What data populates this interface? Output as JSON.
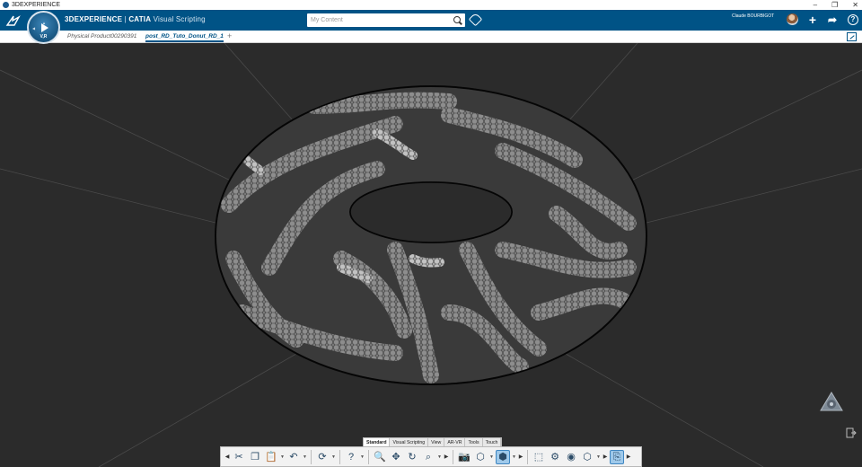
{
  "os_window": {
    "title": "3DEXPERIENCE",
    "controls": [
      "–",
      "❐",
      "✕"
    ]
  },
  "header": {
    "compass_label": "V,R",
    "brand_bold": "3DEXPERIENCE",
    "brand_sep": " | ",
    "brand_product": "CATIA",
    "app_name": " Visual Scripting",
    "search_placeholder": "My Content",
    "user_name": "Claude BOURBIGOT",
    "add_label": "+",
    "share_label": "➦",
    "help_label": "?"
  },
  "tabs": [
    {
      "label": "Physical Product00290391",
      "active": false
    },
    {
      "label": "post_RD_Tuto_Donut_RD_1",
      "active": true
    }
  ],
  "tab_add": "+",
  "action_bar": {
    "sections": [
      {
        "label": "Standard",
        "active": true
      },
      {
        "label": "Visual Scripting",
        "active": false
      },
      {
        "label": "View",
        "active": false
      },
      {
        "label": "AR-VR",
        "active": false
      },
      {
        "label": "Tools",
        "active": false
      },
      {
        "label": "Touch",
        "active": false
      }
    ],
    "tools": [
      {
        "name": "cut-icon",
        "glyph": "✂"
      },
      {
        "name": "copy-icon",
        "glyph": "❐"
      },
      {
        "name": "paste-icon",
        "glyph": "📋"
      },
      {
        "name": "undo-icon",
        "glyph": "↶"
      },
      {
        "name": "update-icon",
        "glyph": "⟳"
      },
      {
        "name": "help-icon",
        "glyph": "?"
      },
      {
        "name": "zoom-icon",
        "glyph": "🔍"
      },
      {
        "name": "pan-icon",
        "glyph": "✥"
      },
      {
        "name": "rotate-icon",
        "glyph": "↻"
      },
      {
        "name": "zoom-area-icon",
        "glyph": "⌕"
      },
      {
        "name": "capture-icon",
        "glyph": "📷"
      },
      {
        "name": "render-style-icon",
        "glyph": "⬡"
      },
      {
        "name": "view-cube-icon",
        "glyph": "⬢"
      },
      {
        "name": "part-add-icon",
        "glyph": "⬚"
      },
      {
        "name": "part-gear-icon",
        "glyph": "⚙"
      },
      {
        "name": "part-view-icon",
        "glyph": "◉"
      },
      {
        "name": "hexagon-icon",
        "glyph": "⬡"
      },
      {
        "name": "export-icon",
        "glyph": "⎘"
      }
    ]
  },
  "colors": {
    "header_bg": "#005386",
    "viewport_bg": "#2b2b2b",
    "accent": "#005386"
  }
}
